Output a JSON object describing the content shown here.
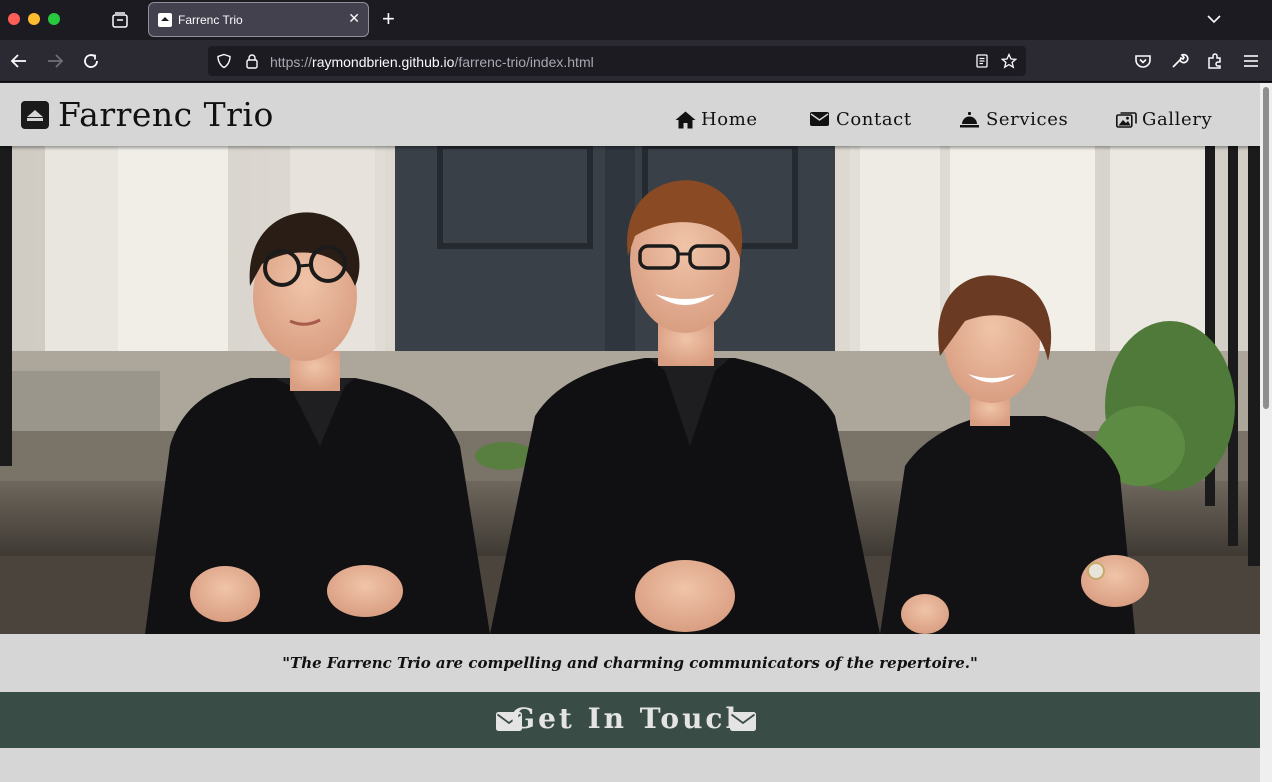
{
  "browser": {
    "tab_title": "Farrenc Trio",
    "url_prefix": "https://",
    "url_host": "raymondbrien.github.io",
    "url_path": "/farrenc-trio/index.html"
  },
  "site": {
    "logo_text": "Farrenc Trio",
    "nav": [
      {
        "label": "Home",
        "icon": "home-icon"
      },
      {
        "label": "Contact",
        "icon": "envelope-icon"
      },
      {
        "label": "Services",
        "icon": "bell-icon"
      },
      {
        "label": "Gallery",
        "icon": "images-icon"
      }
    ],
    "quote": "\"The Farrenc Trio are compelling and charming communicators of the repertoire.\"",
    "contact_heading": "Get In Touch"
  },
  "colors": {
    "header_bg": "#d6d6d6",
    "contact_band": "#394c45",
    "browser_chrome": "#1c1b22"
  }
}
